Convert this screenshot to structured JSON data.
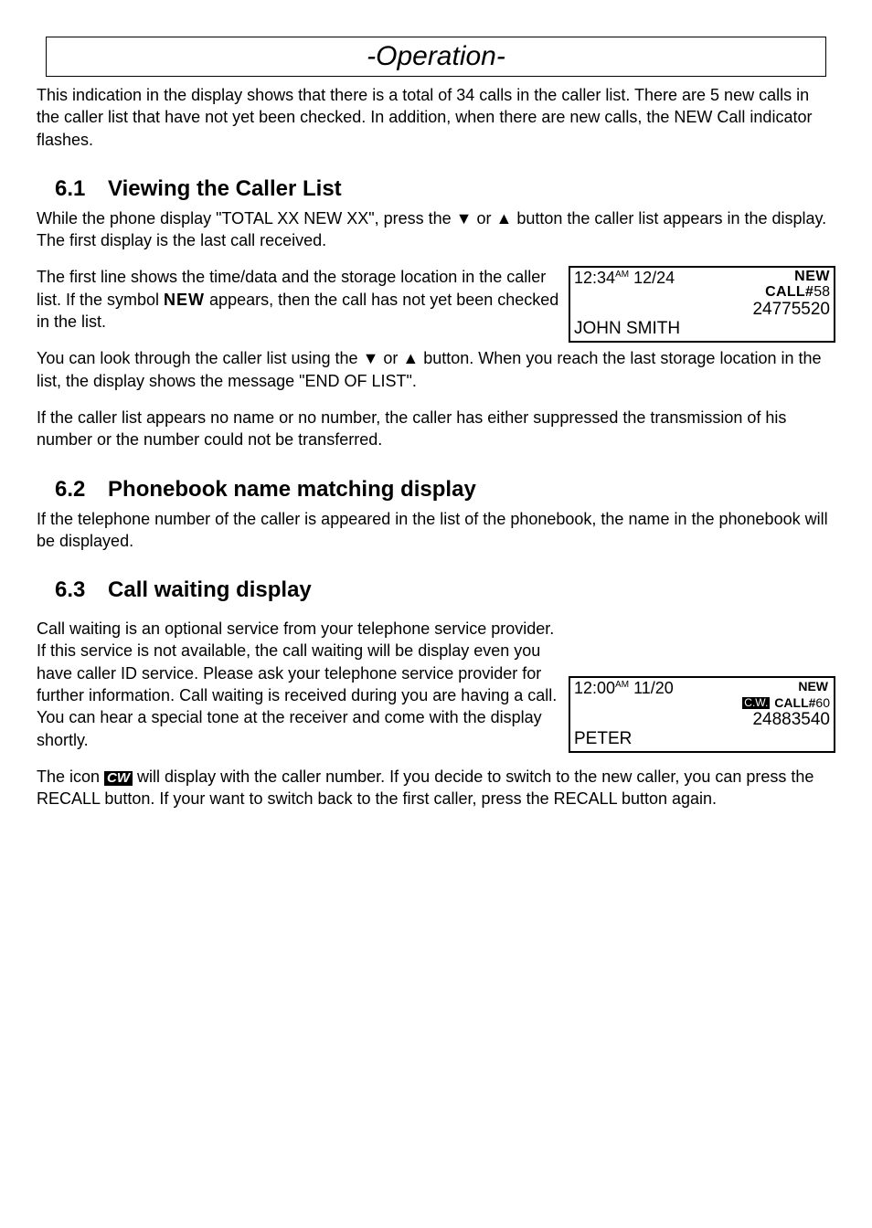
{
  "page_title": "-Operation-",
  "intro_para": "This indication in the display shows that there is a total of 34 calls in the caller list. There are 5 new calls in the caller list that have not yet been checked. In addition, when there are new calls, the NEW Call indicator flashes.",
  "s61": {
    "num": "6.1",
    "title": "Viewing the Caller List",
    "p1_a": "While the phone display \"TOTAL XX NEW XX\", press the ",
    "p1_b": " or ",
    "p1_c": " button the caller list appears in the display.  The first display is the last call received.",
    "p2_a": "The first line shows the time/data and the storage location in the caller list.  If the symbol ",
    "p2_b": " appears, then the call has not yet been checked in the list.",
    "p3_a": "You can look through the caller list using the ",
    "p3_b": " or ",
    "p3_c": " button.  When you reach the last storage location in the list, the display shows the message \"END OF LIST\".",
    "p4": "If the caller list appears no name or no number, the caller has either suppressed the transmission of his number or the number could not be transferred.",
    "lcd": {
      "time_h": "12:34",
      "time_ampm": "AM",
      "date": "12/24",
      "new_label": "NEW",
      "call_label": "CALL#",
      "call_num": "58",
      "number": "24775520",
      "name": "JOHN SMITH"
    },
    "new_symbol": "NEW"
  },
  "s62": {
    "num": "6.2",
    "title": "Phonebook name matching display",
    "p1": "If the telephone number of the caller is appeared in the list of the phonebook, the name in the phonebook will be displayed."
  },
  "s63": {
    "num": "6.3",
    "title": "Call waiting display",
    "p1": "Call waiting is an optional service from your telephone service provider.  If this service is not available, the call waiting will be display even you have caller ID service.  Please ask your telephone service provider for further information.  Call waiting is received during you are having a call.  You can hear a special tone at the receiver and come with the display shortly.",
    "p2_a": "The icon ",
    "p2_b": " will display with the caller number.  If you decide to switch to the new caller, you can press the RECALL button.  If your want to switch back to the first caller, press the RECALL button again.",
    "cw_text": "CW",
    "lcd": {
      "time_h": "12:00",
      "time_ampm": "AM",
      "date": "11/20",
      "cw_label": "C.W.",
      "new_label": "NEW",
      "call_label": "CALL#",
      "call_num": "60",
      "number": "24883540",
      "name": "PETER"
    }
  },
  "glyph": {
    "down": "▼",
    "up": "▲"
  }
}
